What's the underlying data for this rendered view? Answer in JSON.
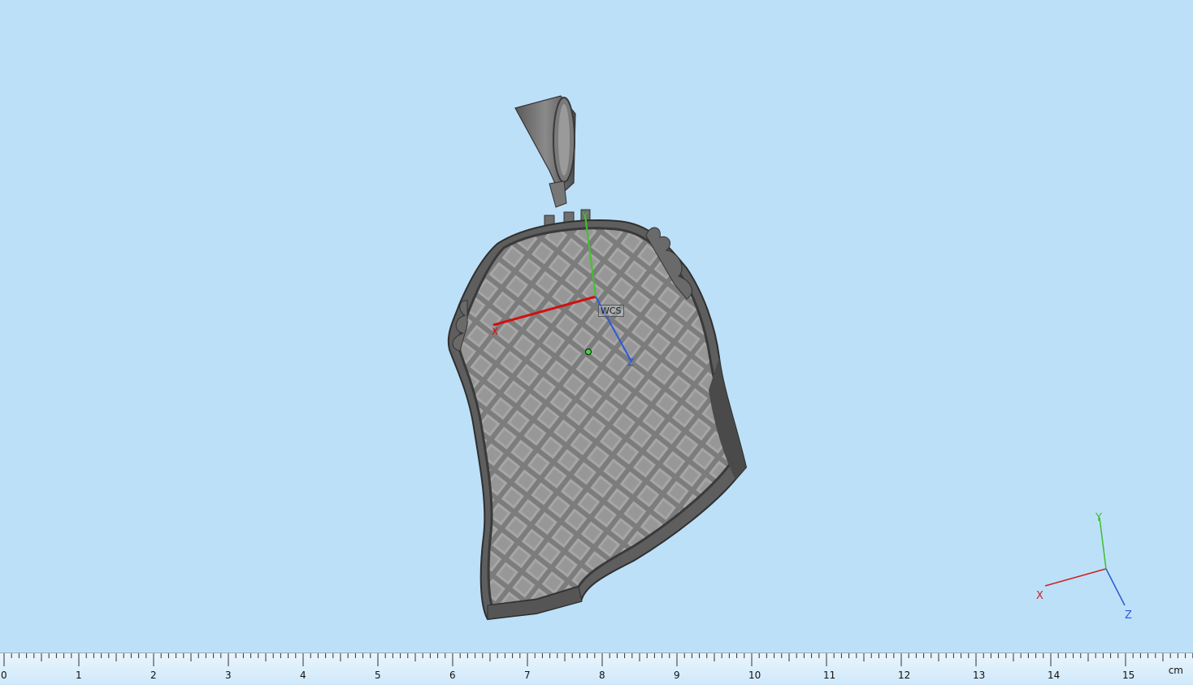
{
  "viewport": {
    "background": "#bde0f9",
    "model": {
      "name": "pendant-lattice-model",
      "color": "#6f6f6f"
    },
    "model_axes": {
      "x_label": "X",
      "y_label": "Y",
      "z_label": "Z",
      "frame_label": "WCS",
      "x_color": "#d01010",
      "y_color": "#3fc32a",
      "z_color": "#2b59d8"
    },
    "orientation_triad": {
      "x_label": "X",
      "y_label": "Y",
      "z_label": "Z",
      "x_color": "#c22",
      "y_color": "#3fbf2a",
      "z_color": "#2a5ad0"
    }
  },
  "ruler": {
    "unit": "cm",
    "labels": [
      "0",
      "1",
      "2",
      "3",
      "4",
      "5",
      "6",
      "7",
      "8",
      "9",
      "10",
      "11",
      "12",
      "13",
      "14",
      "15"
    ]
  }
}
